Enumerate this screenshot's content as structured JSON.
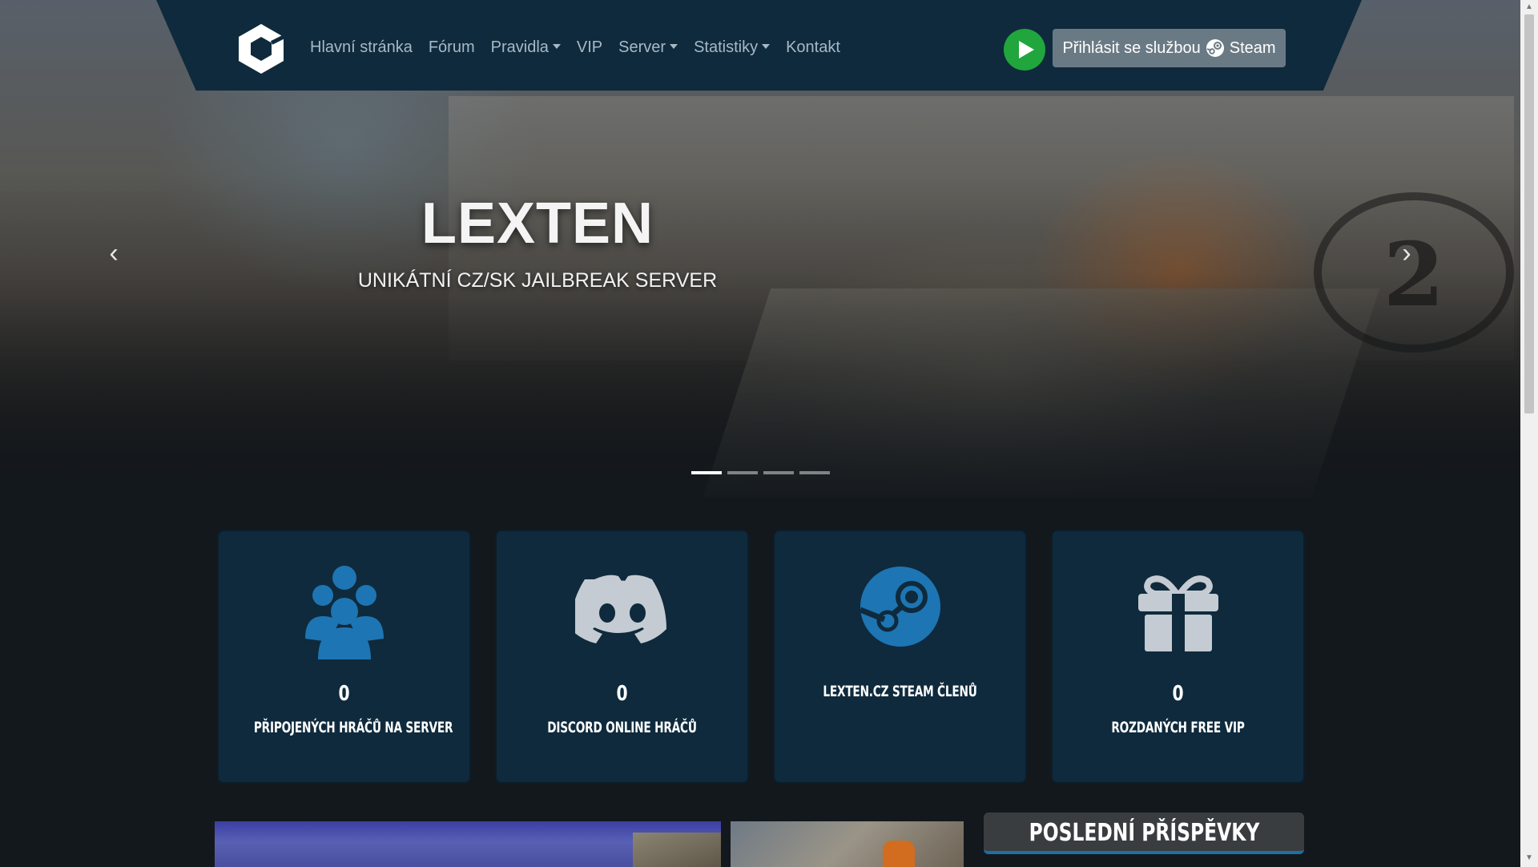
{
  "nav": {
    "logo_icon": "hexagon-cube-logo",
    "links": [
      {
        "label": "Hlavní stránka",
        "dropdown": false
      },
      {
        "label": "Fórum",
        "dropdown": false
      },
      {
        "label": "Pravidla",
        "dropdown": true
      },
      {
        "label": "VIP",
        "dropdown": false
      },
      {
        "label": "Server",
        "dropdown": true
      },
      {
        "label": "Statistiky",
        "dropdown": true
      },
      {
        "label": "Kontakt",
        "dropdown": false
      }
    ],
    "play_icon": "play-icon",
    "steam_login_prefix": "Přihlásit se službou",
    "steam_login_suffix": "Steam"
  },
  "hero": {
    "title": "LEXTEN",
    "subtitle": "UNIKÁTNÍ CZ/SK JAILBREAK SERVER",
    "prev_glyph": "‹",
    "next_glyph": "›",
    "slide_count": 4,
    "active_slide": 1
  },
  "stats": [
    {
      "icon": "users-icon",
      "value": "0",
      "label": "PŘIPOJENÝCH HRÁČŮ NA SERVER"
    },
    {
      "icon": "discord-icon",
      "value": "0",
      "label": "DISCORD ONLINE HRÁČŮ"
    },
    {
      "icon": "steam-icon",
      "value": "",
      "label": "LEXTEN.CZ STEAM ČLENŮ"
    },
    {
      "icon": "gift-icon",
      "value": "0",
      "label": "ROZDANÝCH FREE VIP"
    }
  ],
  "posts": {
    "title": "POSLEDNÍ PŘÍSPĚVKY"
  },
  "colors": {
    "navbar": "#0f2a3c",
    "card": "#0f2a3c",
    "accent_blue": "#1d75b3",
    "play_green": "#20a63c",
    "steam_button": "#6a7a85",
    "background": "#13181d"
  }
}
